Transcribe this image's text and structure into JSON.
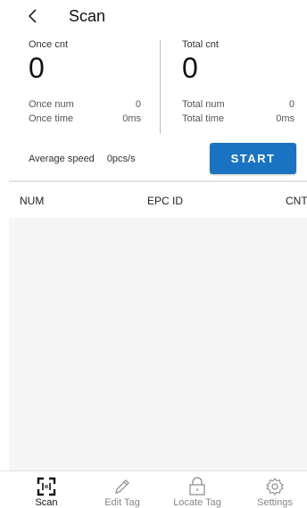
{
  "header": {
    "title": "Scan"
  },
  "once": {
    "cnt_label": "Once cnt",
    "cnt_value": "0",
    "num_label": "Once num",
    "num_value": "0",
    "time_label": "Once time",
    "time_value": "0ms"
  },
  "total": {
    "cnt_label": "Total cnt",
    "cnt_value": "0",
    "num_label": "Total num",
    "num_value": "0",
    "time_label": "Total time",
    "time_value": "0ms"
  },
  "speed": {
    "label": "Average speed",
    "value": "0pcs/s"
  },
  "start_label": "START",
  "table": {
    "headers": [
      "NUM",
      "EPC ID",
      "CNT"
    ],
    "rows": []
  },
  "tabs": [
    {
      "label": "Scan",
      "icon": "scan-icon",
      "active": true
    },
    {
      "label": "Edit Tag",
      "icon": "pencil-icon",
      "active": false
    },
    {
      "label": "Locate Tag",
      "icon": "lock-icon",
      "active": false
    },
    {
      "label": "Settings",
      "icon": "gear-icon",
      "active": false
    }
  ],
  "colors": {
    "accent": "#1a73c2",
    "list_bg": "#f5f5f5"
  }
}
